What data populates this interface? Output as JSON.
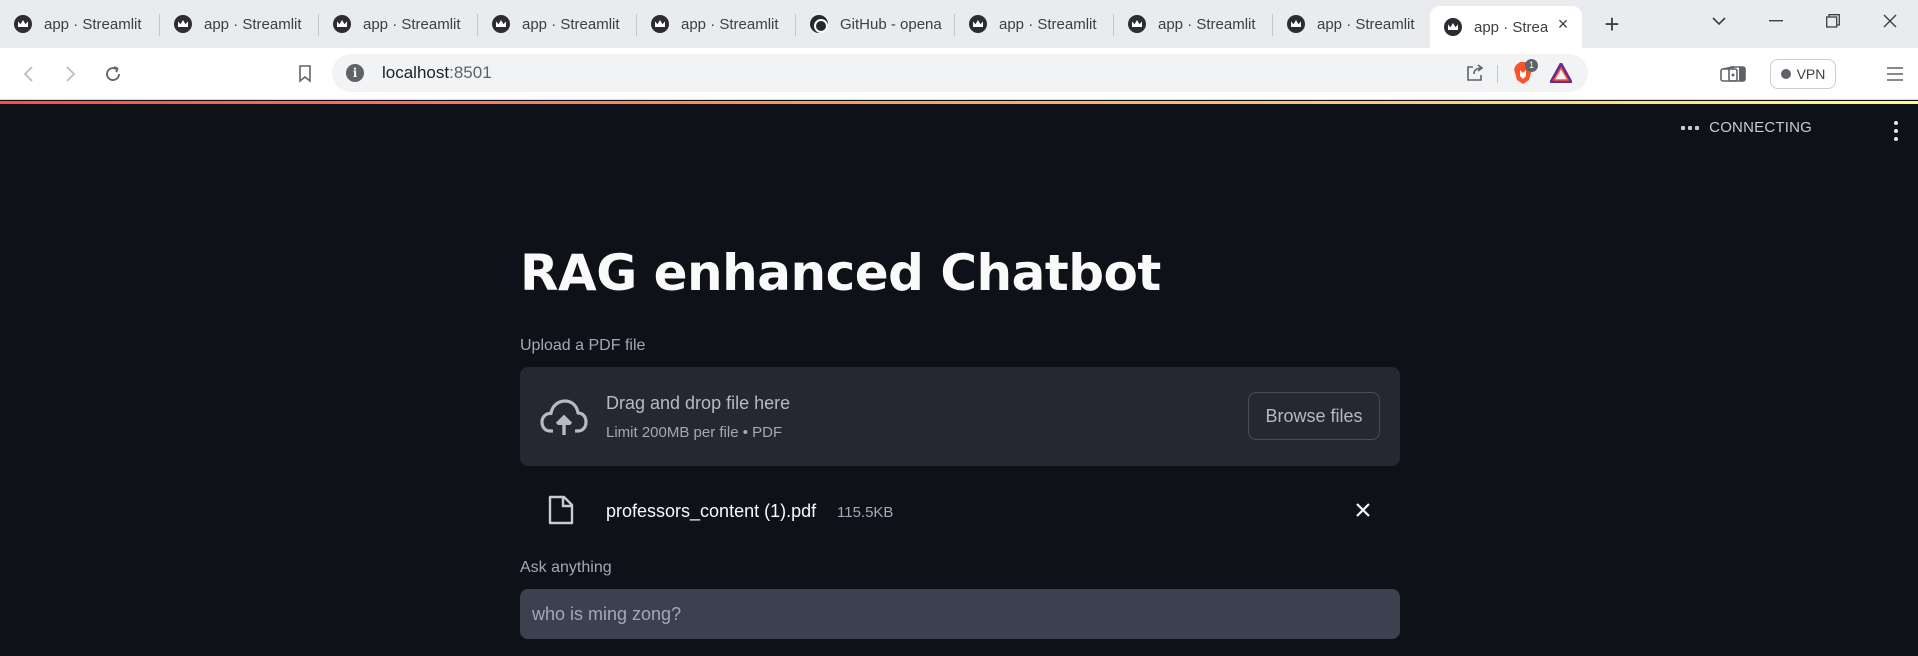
{
  "browser": {
    "tabs": [
      {
        "title": "app · Streamlit",
        "icon": "streamlit-crown-icon"
      },
      {
        "title": "app · Streamlit",
        "icon": "streamlit-crown-icon"
      },
      {
        "title": "app · Streamlit",
        "icon": "streamlit-crown-icon"
      },
      {
        "title": "app · Streamlit",
        "icon": "streamlit-crown-icon"
      },
      {
        "title": "app · Streamlit",
        "icon": "streamlit-crown-icon"
      },
      {
        "title": "GitHub - opena",
        "icon": "github-icon"
      },
      {
        "title": "app · Streamlit",
        "icon": "streamlit-crown-icon"
      },
      {
        "title": "app · Streamlit",
        "icon": "streamlit-crown-icon"
      },
      {
        "title": "app · Streamlit",
        "icon": "streamlit-crown-icon"
      },
      {
        "title": "app · Strea",
        "icon": "streamlit-crown-icon",
        "active": true
      }
    ],
    "url_host": "localhost",
    "url_port": ":8501",
    "vpn_label": "VPN",
    "brave_badge": "1"
  },
  "app": {
    "status": "CONNECTING",
    "title": "RAG enhanced Chatbot",
    "upload": {
      "label": "Upload a PDF file",
      "drag_text": "Drag and drop file here",
      "limit_text": "Limit 200MB per file • PDF",
      "browse_label": "Browse files"
    },
    "uploaded_file": {
      "name": "professors_content (1).pdf",
      "size": "115.5KB"
    },
    "ask": {
      "label": "Ask anything",
      "value": "who is ming zong?"
    }
  },
  "colors": {
    "app_bg": "#0e1117",
    "dropzone_bg": "#262730",
    "input_bg": "#3b414f",
    "accent_gradient_start": "#ff4b4b",
    "accent_gradient_end": "#fffd80"
  }
}
